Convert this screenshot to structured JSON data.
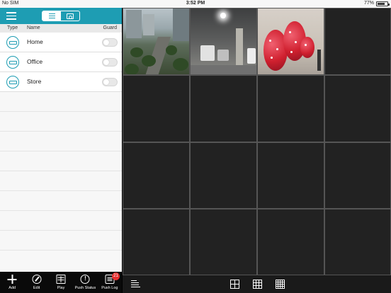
{
  "status_bar": {
    "carrier": "No SIM",
    "time": "3:52 PM",
    "battery": "77%"
  },
  "left_panel": {
    "toolbar": {
      "menu_icon": "hamburger-icon",
      "segments": [
        {
          "icon": "list-icon",
          "active": true
        },
        {
          "icon": "device-icon",
          "active": false
        }
      ]
    },
    "columns": {
      "type": "Type",
      "name": "Name",
      "guard": "Guard"
    },
    "devices": [
      {
        "name": "Home",
        "guard_on": false
      },
      {
        "name": "Office",
        "guard_on": false
      },
      {
        "name": "Store",
        "guard_on": false
      }
    ]
  },
  "bottom_tabs": [
    {
      "label": "Add",
      "icon": "add-icon"
    },
    {
      "label": "Edit",
      "icon": "edit-icon"
    },
    {
      "label": "Play",
      "icon": "play-icon"
    },
    {
      "label": "Push Status",
      "icon": "push-status-icon"
    },
    {
      "label": "Push Log",
      "icon": "push-log-icon"
    }
  ],
  "push_log_badge": "21",
  "camera_grid": {
    "columns": 4,
    "rows": 4,
    "active_feeds": [
      "street-camera",
      "parking-camera",
      "balloon-camera"
    ]
  },
  "view_bar": {
    "icons": [
      "camera-list-icon",
      "grid-2x2-icon",
      "grid-3x3-icon",
      "grid-4x4-icon"
    ]
  },
  "colors": {
    "accent": "#1e9db3",
    "badge": "#e53030",
    "grid_background": "#222222"
  }
}
